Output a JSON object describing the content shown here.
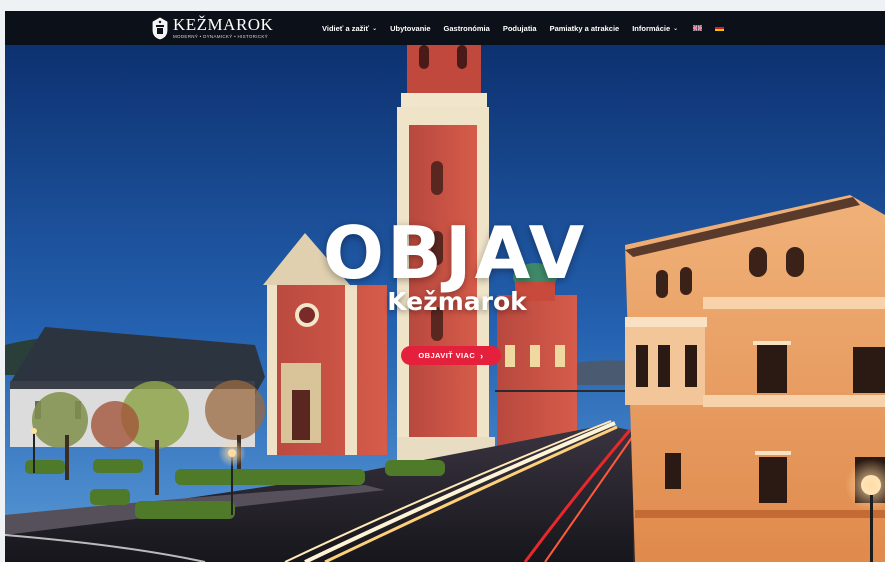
{
  "brand": {
    "name": "KEŽMAROK",
    "tagline": "MODERNÝ • DYNAMICKÝ • HISTORICKÝ"
  },
  "nav": {
    "items": [
      {
        "label": "Vidieť a zažiť",
        "has_dropdown": true
      },
      {
        "label": "Ubytovanie",
        "has_dropdown": false
      },
      {
        "label": "Gastronómia",
        "has_dropdown": false
      },
      {
        "label": "Podujatia",
        "has_dropdown": false
      },
      {
        "label": "Pamiatky a atrakcie",
        "has_dropdown": false
      },
      {
        "label": "Informácie",
        "has_dropdown": true
      }
    ],
    "languages": [
      {
        "code": "en",
        "icon": "uk-flag-icon"
      },
      {
        "code": "de",
        "icon": "germany-flag-icon"
      }
    ],
    "dropdown_icon": "chevron-down-icon"
  },
  "hero": {
    "title": "OBJAV",
    "subtitle": "Kežmarok",
    "cta_label": "OBJAVIŤ VIAC",
    "cta_icon": "chevron-right-icon"
  },
  "colors": {
    "nav_background": "#0c1018",
    "cta": "#e4203d",
    "sky_top": "#0d3170",
    "sky_bottom": "#3c84cc"
  }
}
